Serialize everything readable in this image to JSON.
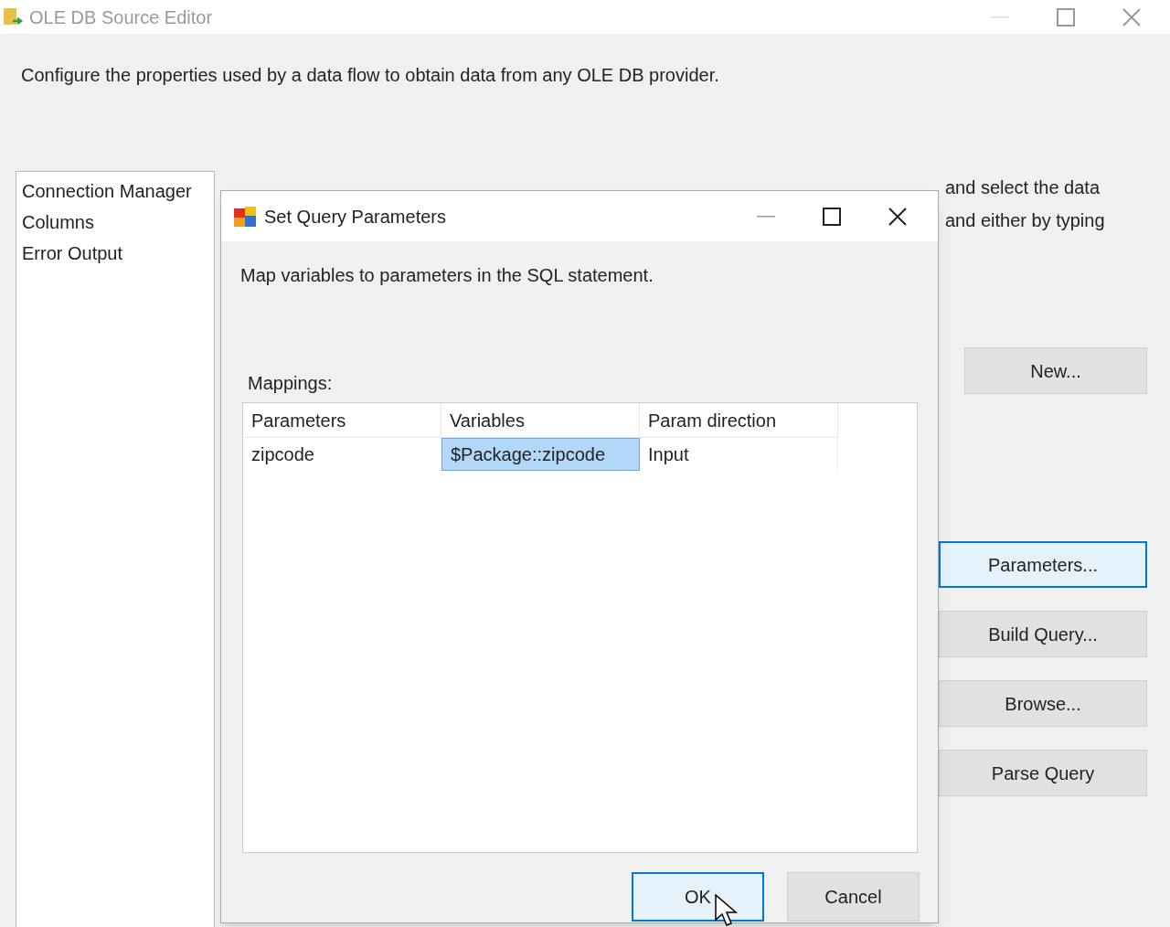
{
  "window": {
    "title": "OLE DB Source Editor",
    "description": "Configure the properties used by a data flow to obtain data from any OLE DB provider."
  },
  "sidebar": {
    "items": [
      "Connection Manager",
      "Columns",
      "Error Output"
    ]
  },
  "background_text": [
    "and select the data",
    "and either by typing"
  ],
  "side_buttons": [
    {
      "label": "New...",
      "focused": false
    },
    {
      "label": "Parameters...",
      "focused": true
    },
    {
      "label": "Build Query...",
      "focused": false
    },
    {
      "label": "Browse...",
      "focused": false
    },
    {
      "label": "Parse Query",
      "focused": false
    }
  ],
  "dialog": {
    "title": "Set Query Parameters",
    "description": "Map variables to parameters in the SQL statement.",
    "mappings_label": "Mappings:",
    "table": {
      "columns": [
        "Parameters",
        "Variables",
        "Param direction"
      ],
      "rows": [
        [
          {
            "text": "zipcode",
            "selected": false
          },
          {
            "text": "$Package::zipcode",
            "selected": true
          },
          {
            "text": "Input",
            "selected": false
          }
        ]
      ]
    },
    "buttons": [
      {
        "label": "OK",
        "focused": true
      },
      {
        "label": "Cancel",
        "focused": false
      }
    ]
  }
}
